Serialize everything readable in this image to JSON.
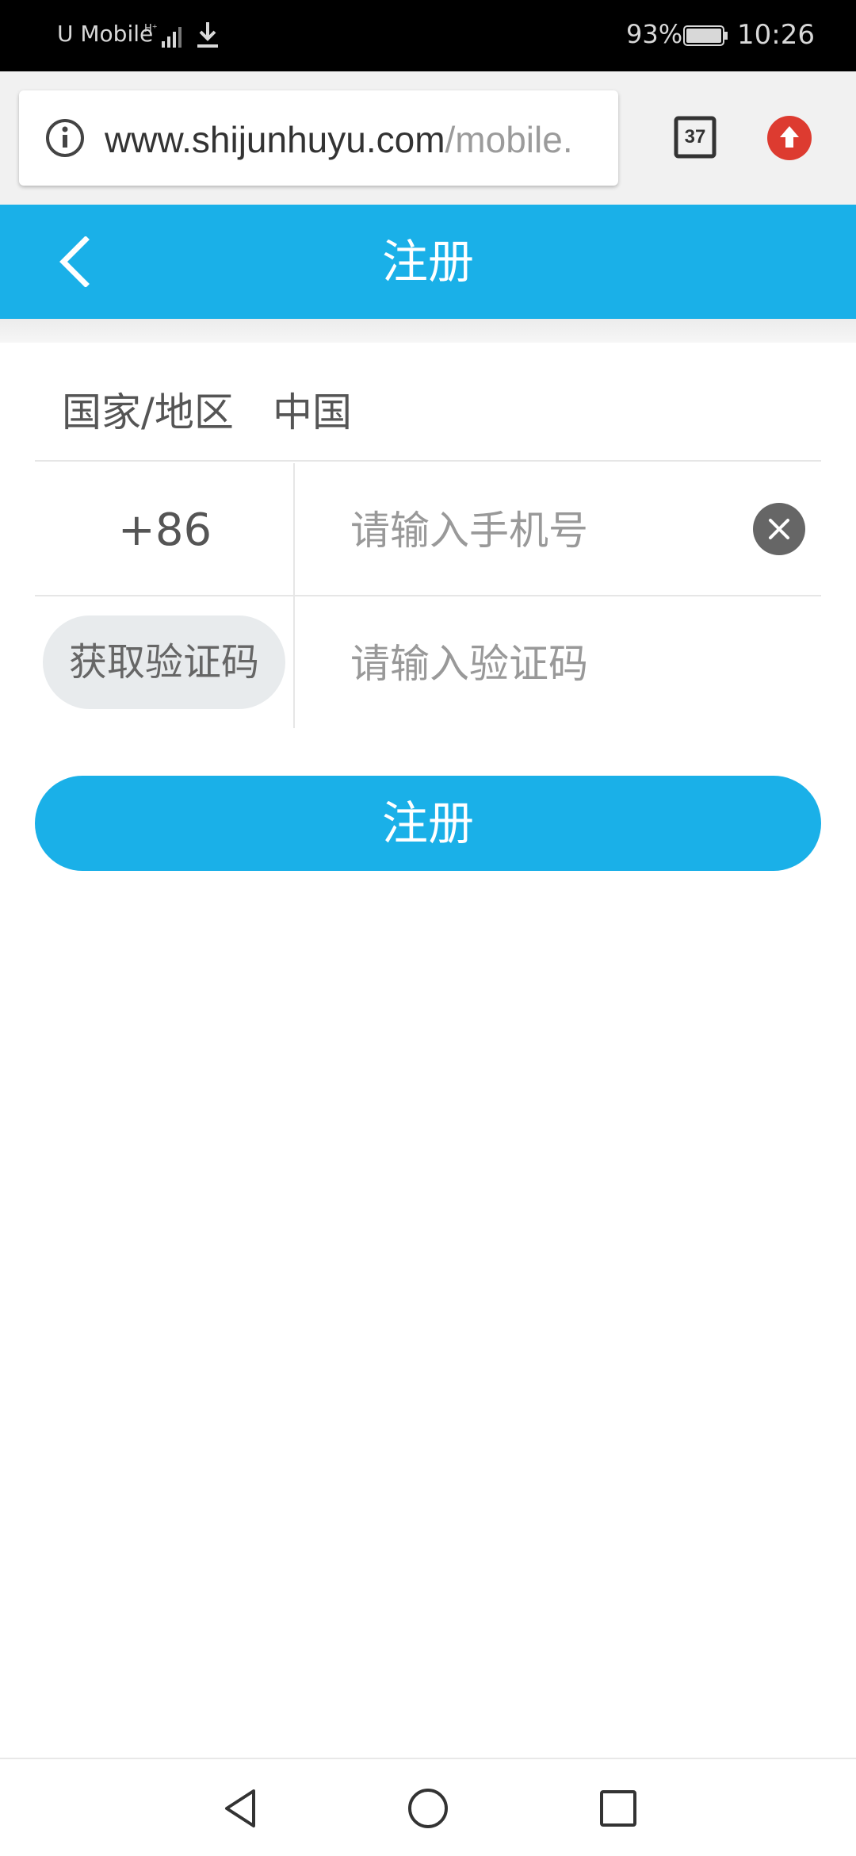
{
  "status_bar": {
    "carrier": "U Mobile",
    "battery_percent": "93%",
    "time": "10:26"
  },
  "browser": {
    "url_host": "www.shijunhuyu.com",
    "url_path": "/mobile.",
    "tab_count": "37"
  },
  "header": {
    "title": "注册"
  },
  "form": {
    "country_label": "国家/地区",
    "country_value": "中国",
    "country_code": "+86",
    "phone_placeholder": "请输入手机号",
    "get_code_label": "获取验证码",
    "code_placeholder": "请输入验证码",
    "submit_label": "注册"
  },
  "colors": {
    "accent": "#1ab0e8",
    "upload_red": "#dd3b30",
    "clear_gray": "#666666"
  },
  "icons": {
    "back": "chevron-left-icon",
    "info": "info-icon",
    "tabs": "tabs-icon",
    "upload": "upload-icon",
    "clear": "close-circle-icon"
  }
}
